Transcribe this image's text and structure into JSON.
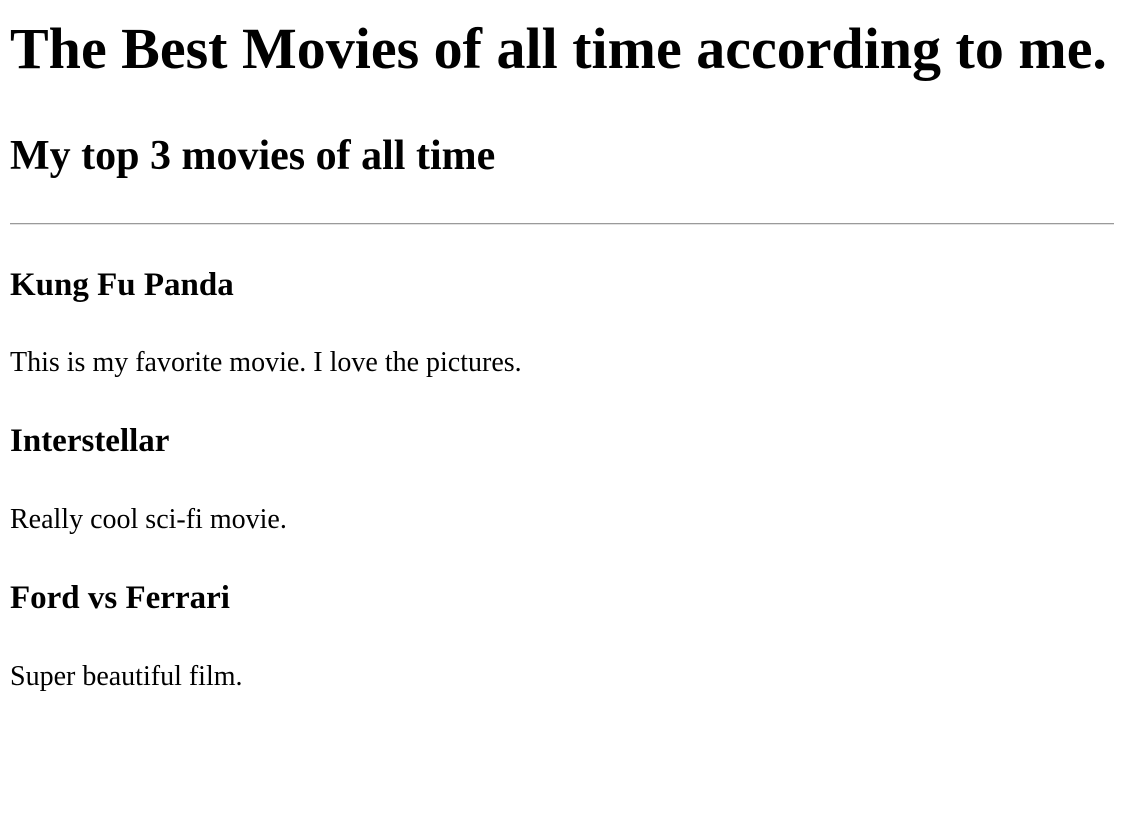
{
  "page": {
    "title": "The Best Movies of all time according to me.",
    "subtitle": "My top 3 movies of all time"
  },
  "movies": [
    {
      "title": "Kung Fu Panda",
      "description": "This is my favorite movie. I love the pictures."
    },
    {
      "title": "Interstellar",
      "description": "Really cool sci-fi movie."
    },
    {
      "title": "Ford vs Ferrari",
      "description": "Super beautiful film."
    }
  ]
}
